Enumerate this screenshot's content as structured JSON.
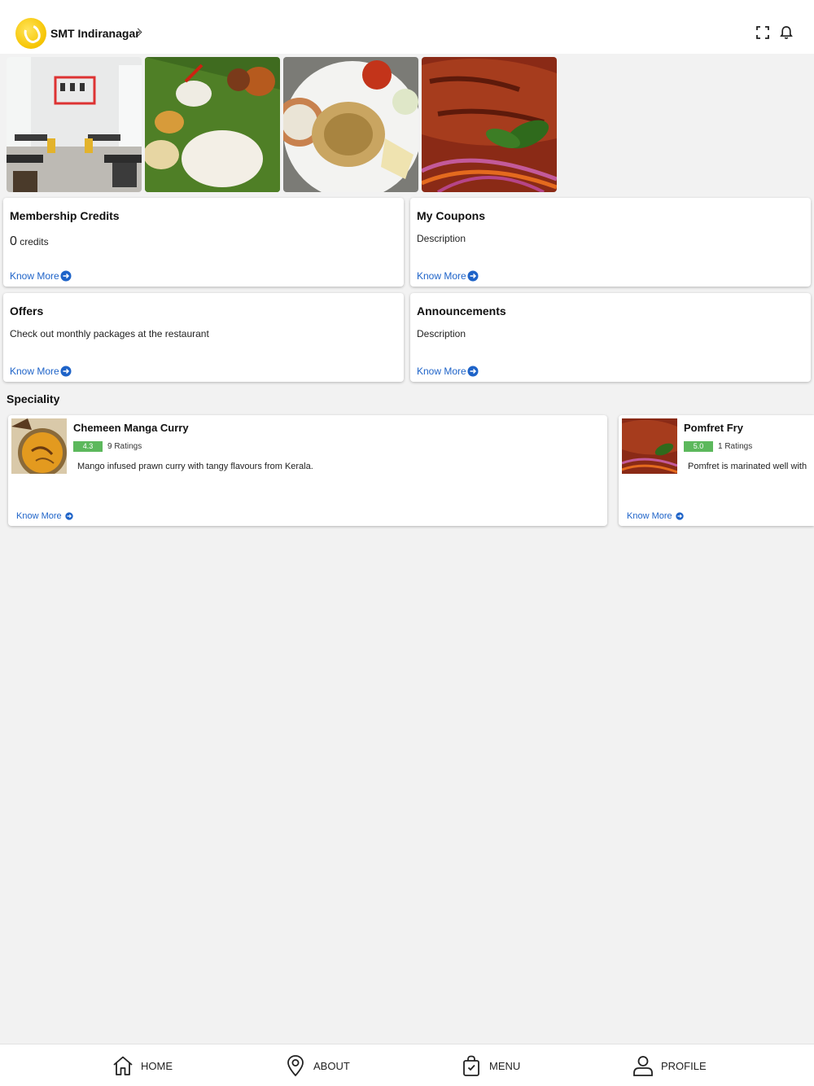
{
  "header": {
    "restaurant_name": "SMT Indiranagar"
  },
  "gallery": [
    {
      "name": "restaurant-interior"
    },
    {
      "name": "banana-leaf-meal"
    },
    {
      "name": "biryani-plate"
    },
    {
      "name": "fried-fish"
    }
  ],
  "cards": {
    "membership": {
      "title": "Membership Credits",
      "credits_value": "0",
      "credits_unit": "credits",
      "link": "Know More"
    },
    "coupons": {
      "title": "My Coupons",
      "description": "Description",
      "link": "Know More"
    },
    "offers": {
      "title": "Offers",
      "description": "Check out monthly packages at the restaurant",
      "link": "Know More"
    },
    "announcements": {
      "title": "Announcements",
      "description": "Description",
      "link": "Know More"
    }
  },
  "speciality": {
    "title": "Speciality",
    "items": [
      {
        "name": "Chemeen Manga Curry",
        "rating": "4.3",
        "ratings_count": "9 Ratings",
        "description": "Mango infused prawn curry with tangy flavours from Kerala.",
        "link": "Know More"
      },
      {
        "name": "Pomfret Fry",
        "rating": "5.0",
        "ratings_count": "1 Ratings",
        "description": "Pomfret is marinated well with",
        "link": "Know More"
      }
    ]
  },
  "nav": {
    "home": "HOME",
    "about": "ABOUT",
    "menu": "MENU",
    "profile": "PROFILE"
  },
  "colors": {
    "accent_link": "#1e63c8",
    "rating_badge": "#5cb85c",
    "logo_yellow": "#f6c400",
    "background": "#f2f2f2"
  }
}
